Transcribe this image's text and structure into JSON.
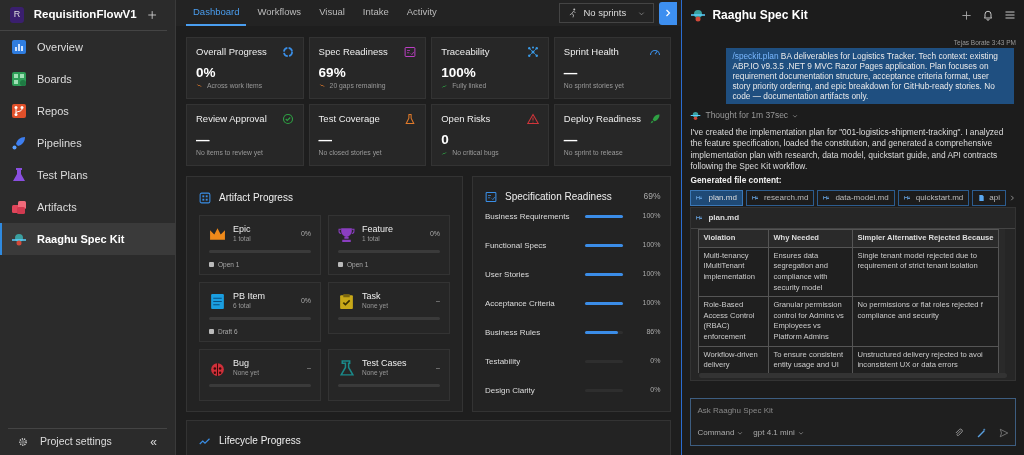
{
  "sidebar": {
    "project": {
      "initial": "R",
      "name": "RequisitionFlowV1"
    },
    "items": [
      {
        "label": "Overview",
        "selected": false
      },
      {
        "label": "Boards",
        "selected": false
      },
      {
        "label": "Repos",
        "selected": false
      },
      {
        "label": "Pipelines",
        "selected": false
      },
      {
        "label": "Test Plans",
        "selected": false
      },
      {
        "label": "Artifacts",
        "selected": false
      },
      {
        "label": "Raaghu Spec Kit",
        "selected": true
      }
    ],
    "settings": "Project settings",
    "collapse": "«"
  },
  "tabs": [
    {
      "label": "Dashboard",
      "selected": true
    },
    {
      "label": "Workflows",
      "selected": false
    },
    {
      "label": "Visual",
      "selected": false
    },
    {
      "label": "Intake",
      "selected": false
    },
    {
      "label": "Activity",
      "selected": false
    }
  ],
  "sprint_filter": {
    "label": "No sprints"
  },
  "metrics": [
    {
      "title": "Overall Progress",
      "value": "0%",
      "note": "Across work items",
      "rising": false
    },
    {
      "title": "Spec Readiness",
      "value": "69%",
      "note": "20 gaps remaining",
      "rising": false
    },
    {
      "title": "Traceability",
      "value": "100%",
      "note": "Fully linked",
      "rising": true
    },
    {
      "title": "Sprint Health",
      "value": "—",
      "note": "No sprint stories yet"
    },
    {
      "title": "Review Approval",
      "value": "—",
      "note": "No items to review yet"
    },
    {
      "title": "Test Coverage",
      "value": "—",
      "note": "No closed stories yet"
    },
    {
      "title": "Open Risks",
      "value": "0",
      "note": "No critical bugs",
      "rising": true
    },
    {
      "title": "Deploy Readiness",
      "value": "—",
      "note": "No sprint to release"
    }
  ],
  "artifact_progress": {
    "title": "Artifact Progress",
    "items": [
      {
        "name": "Epic",
        "total": "1 total",
        "percent": "0%",
        "level": 0,
        "legend": "Open 1"
      },
      {
        "name": "Feature",
        "total": "1 total",
        "percent": "0%",
        "level": 0,
        "legend": "Open 1"
      },
      {
        "name": "PB Item",
        "total": "6 total",
        "percent": "0%",
        "level": 0,
        "legend": "Draft 6"
      },
      {
        "name": "Task",
        "total": "None yet",
        "percent": "–",
        "level": 0
      },
      {
        "name": "Bug",
        "total": "None yet",
        "percent": "–",
        "level": 0
      },
      {
        "name": "Test Cases",
        "total": "None yet",
        "percent": "–",
        "level": 0
      }
    ]
  },
  "spec_readiness": {
    "title": "Specification Readiness",
    "total": "69%",
    "rows": [
      {
        "label": "Business Requirements",
        "level": 1,
        "reading": "100%"
      },
      {
        "label": "Functional Specs",
        "level": 1,
        "reading": "100%"
      },
      {
        "label": "User Stories",
        "level": 1,
        "reading": "100%"
      },
      {
        "label": "Acceptance Criteria",
        "level": 1,
        "reading": "100%"
      },
      {
        "label": "Business Rules",
        "level": 0.86,
        "reading": "86%"
      },
      {
        "label": "Testability",
        "level": 0,
        "reading": "0%"
      },
      {
        "label": "Design Clarity",
        "level": 0,
        "reading": "0%"
      }
    ]
  },
  "lifecycle": {
    "title": "Lifecycle Progress"
  },
  "chat": {
    "title": "Raaghu Spec Kit",
    "message": {
      "meta": "Tejas Borate 3:43 PM",
      "command": "/speckit.plan",
      "text": " BA deliverables for Logistics Tracker. Tech context: existing ABP.IO v9.3.5 .NET 9 MVC Razor Pages application. Plan focuses on requirement documentation structure, acceptance criteria format, user story priority ordering, and epic breakdown for GitHub-ready stories. No code — documentation artifacts only."
    },
    "thought": "Thought for 1m 37sec",
    "reply": "I've created the implementation plan for \"001-logistics-shipment-tracking\". I analyzed the feature specification, loaded the constitution, and generated a comprehensive implementation plan with research, data model, quickstart guide, and API contracts following the Spec Kit workflow.",
    "generated_label": "Generated file content:",
    "files": [
      {
        "name": "plan.md",
        "selected": true
      },
      {
        "name": "research.md",
        "selected": false
      },
      {
        "name": "data-model.md",
        "selected": false
      },
      {
        "name": "quickstart.md",
        "selected": false
      },
      {
        "name": "api",
        "selected": false
      }
    ],
    "document": {
      "name": "plan.md",
      "columns": [
        "Violation",
        "Why Needed",
        "Simpler Alternative Rejected Because"
      ],
      "rows": [
        [
          "Multi-tenancy IMultiTenant implementation",
          "Ensures data segregation and compliance with security model",
          "Single tenant model rejected due to requirement of strict tenant isolation"
        ],
        [
          "Role-Based Access Control (RBAC) enforcement",
          "Granular permission control for Admins vs Employees vs Platform Admins",
          "No permissions or flat roles rejected f compliance and security"
        ],
        [
          "Workflow-driven delivery",
          "To ensure consistent entity usage and UI",
          "Unstructured delivery rejected to avoi inconsistent UX or data errors"
        ]
      ]
    },
    "input": {
      "placeholder": "Ask Raaghu Spec Kit",
      "mode": "Command",
      "model": "gpt 4.1 mini"
    }
  }
}
